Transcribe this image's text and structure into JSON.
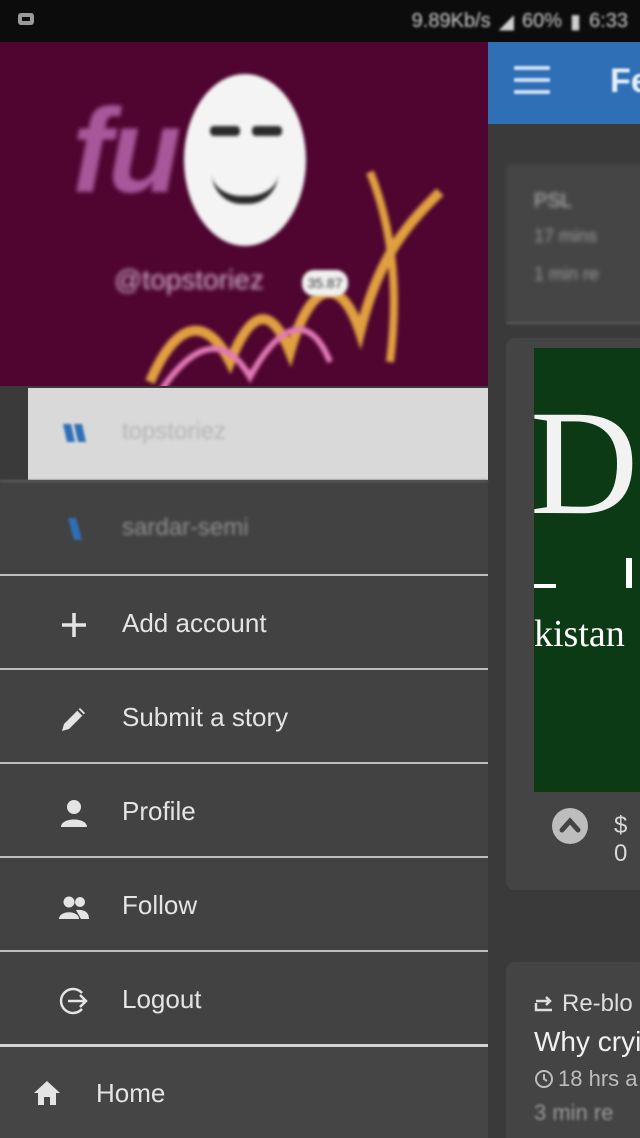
{
  "status_bar": {
    "speed": "9.89Kb/s",
    "battery": "60%",
    "time": "6:33"
  },
  "drawer": {
    "profile_header": {
      "logo_text": "fu",
      "handle": "@topstoriez",
      "reputation_badge": "35.87"
    },
    "accounts": [
      {
        "label": "topstoriez",
        "selected": true
      },
      {
        "label": "sardar-semi",
        "selected": false
      }
    ],
    "menu": [
      {
        "label": "Add account",
        "icon": "plus-icon"
      },
      {
        "label": "Submit a story",
        "icon": "pencil-icon"
      },
      {
        "label": "Profile",
        "icon": "person-icon"
      },
      {
        "label": "Follow",
        "icon": "people-icon"
      },
      {
        "label": "Logout",
        "icon": "logout-icon"
      }
    ],
    "home": {
      "label": "Home",
      "icon": "home-icon"
    }
  },
  "feed": {
    "appbar_title": "Fe",
    "card1": {
      "title": "PSL",
      "meta1": "17 mins",
      "meta2": "1 min re"
    },
    "card2": {
      "image_text_big": "Da",
      "image_text_small": "kistan",
      "price": "$ 0"
    },
    "card3": {
      "reblog_label": "Re-blo",
      "headline": "Why cryi",
      "time": "18 hrs a",
      "read": "3 min re"
    }
  },
  "colors": {
    "drawer_bg": "#424242",
    "header_bg": "#4f0530",
    "appbar_blue": "#2f6fb6",
    "selected_account_bg": "#d9d9d9"
  }
}
